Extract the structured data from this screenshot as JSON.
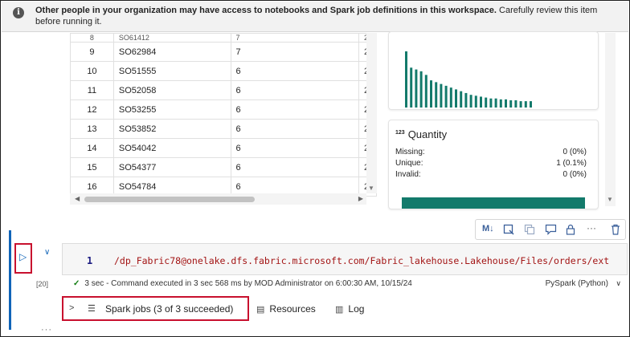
{
  "banner": {
    "bold_text": "Other people in your organization may have access to notebooks and Spark job definitions in this workspace.",
    "normal_text": " Carefully review this item before running it."
  },
  "table": {
    "rows": [
      [
        "8",
        "SO61412",
        "7",
        "2"
      ],
      [
        "9",
        "SO62984",
        "7",
        "2"
      ],
      [
        "10",
        "SO51555",
        "6",
        "2"
      ],
      [
        "11",
        "SO52058",
        "6",
        "2"
      ],
      [
        "12",
        "SO53255",
        "6",
        "2"
      ],
      [
        "13",
        "SO53852",
        "6",
        "2"
      ],
      [
        "14",
        "SO54042",
        "6",
        "2"
      ],
      [
        "15",
        "SO54377",
        "6",
        "2"
      ],
      [
        "16",
        "SO54784",
        "6",
        "2"
      ]
    ]
  },
  "mini_chart": {
    "bar_color": "#137a6b",
    "values": [
      62,
      44,
      42,
      40,
      36,
      30,
      28,
      26,
      24,
      22,
      20,
      18,
      16,
      14,
      13,
      12,
      11,
      10,
      10,
      9,
      9,
      8,
      8,
      7,
      7,
      7
    ]
  },
  "quantity_card": {
    "type_badge": "123",
    "title": "Quantity",
    "stats": [
      {
        "label": "Missing:",
        "value": "0 (0%)"
      },
      {
        "label": "Unique:",
        "value": "1 (0.1%)"
      },
      {
        "label": "Invalid:",
        "value": "0 (0%)"
      }
    ],
    "bar_color": "#137a6b"
  },
  "toolbar": {
    "markdown_label": "M↓",
    "more_label": "···"
  },
  "cell": {
    "exec_count": "[20]",
    "line_number": "1",
    "code": "/dp_Fabric78@onelake.dfs.fabric.microsoft.com/Fabric_lakehouse.Lakehouse/Files/orders/ext",
    "status": "3 sec - Command executed in 3 sec 568 ms by MOD Administrator on 6:00:30 AM, 10/15/24",
    "language": "PySpark (Python)"
  },
  "output_tabs": {
    "spark_jobs": "Spark jobs (3 of 3 succeeded)",
    "resources": "Resources",
    "log": "Log"
  },
  "more_dots": "···",
  "colors": {
    "accent": "#1064b8",
    "highlight": "#c8102e",
    "success": "#107c10"
  }
}
